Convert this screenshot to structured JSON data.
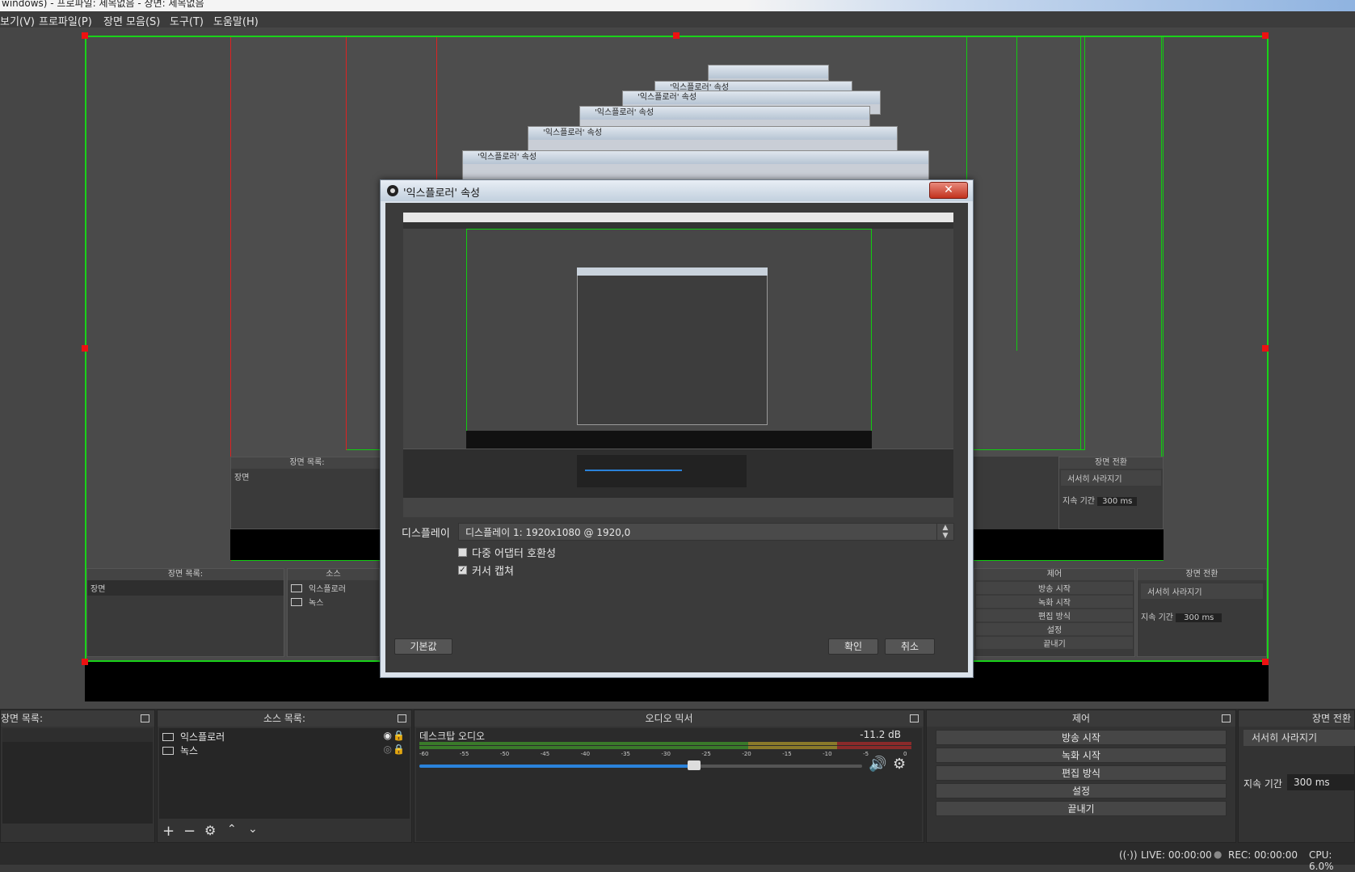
{
  "window_title": "windows) - 프로파일: 제목없음 - 장면: 제목없음",
  "menu": [
    "보기(V)",
    "프로파일(P)",
    "장면 모음(S)",
    "도구(T)",
    "도움말(H)"
  ],
  "dialog": {
    "title": "'익스플로러' 속성",
    "close": "✕",
    "display_label": "디스플레이",
    "display_value": "디스플레이 1: 1920x1080 @ 1920,0",
    "multi_adapter": "다중 어댑터 호환성",
    "multi_adapter_checked": false,
    "capture_cursor": "커서 캡쳐",
    "capture_cursor_checked": true,
    "defaults_button": "기본값",
    "ok_button": "확인",
    "cancel_button": "취소"
  },
  "nested": {
    "win_title": "'익스플로러' 속성",
    "scene_list": "장면 목록:",
    "scene_item": "장면",
    "source_item_1": "익스플로러",
    "source_item_2": "녹스",
    "src_hdr_cut": "소스",
    "controls": "제어",
    "transition": "장면 전환",
    "fade": "서서히 사라지기",
    "duration_label": "지속 기간",
    "duration_value": "300 ms",
    "start_stream": "방송 시작",
    "start_rec": "녹화 시작",
    "studio_mode": "편집 방식",
    "settings": "설정",
    "exit": "끝내기"
  },
  "docks": {
    "scenes": {
      "title": "장면 목록:"
    },
    "sources": {
      "title": "소스 목록:",
      "items": [
        "익스플로러",
        "녹스"
      ]
    },
    "mixer": {
      "title": "오디오 믹서",
      "track": "데스크탑 오디오",
      "level": "-11.2 dB",
      "ticks": [
        "-60",
        "-55",
        "-50",
        "-45",
        "-40",
        "-35",
        "-30",
        "-25",
        "-20",
        "-15",
        "-10",
        "-5",
        "0"
      ],
      "volume_fraction": 0.62
    },
    "controls": {
      "title": "제어",
      "buttons": [
        "방송 시작",
        "녹화 시작",
        "편집 방식",
        "설정",
        "끝내기"
      ]
    },
    "transitions": {
      "title": "장면 전환",
      "selected": "서서히 사라지기",
      "duration_label": "지속 기간",
      "duration_value": "300 ms"
    }
  },
  "status": {
    "live": "LIVE: 00:00:00",
    "rec": "REC: 00:00:00",
    "cpu": "CPU: 6.0%"
  },
  "colors": {
    "accent": "#2a82da",
    "selection_green": "#19d219",
    "handle_red": "#e11111"
  }
}
